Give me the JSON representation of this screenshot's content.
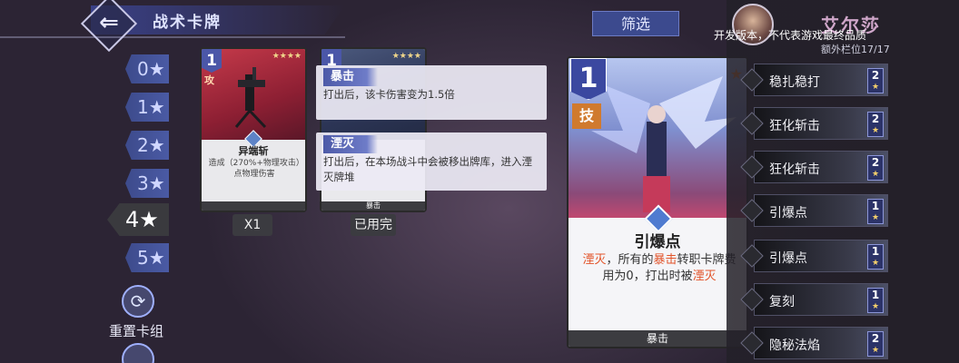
{
  "header": {
    "title": "战术卡牌",
    "back_glyph": "⇐"
  },
  "watermark": "开发版本，不代表游戏最终品质",
  "filter_button": "筛选",
  "star_filters": [
    {
      "label": "0★",
      "active": false
    },
    {
      "label": "1★",
      "active": false
    },
    {
      "label": "2★",
      "active": false
    },
    {
      "label": "3★",
      "active": false
    },
    {
      "label": "4★",
      "active": true
    },
    {
      "label": "5★",
      "active": false
    }
  ],
  "reset_deck": {
    "label": "重置卡组",
    "icon": "refresh-icon"
  },
  "cards": [
    {
      "cost": "1",
      "type": "攻",
      "stars": "★★★★",
      "name": "异端斩",
      "desc": "造成（270%+物理攻击）点物理伤害",
      "footer": "",
      "count": "X1"
    },
    {
      "cost": "1",
      "type": "",
      "stars": "★★★★",
      "name": "",
      "desc": "",
      "footer": "暴击",
      "count": "已用完"
    }
  ],
  "tooltips": [
    {
      "title": "暴击",
      "text": "打出后，该卡伤害变为1.5倍"
    },
    {
      "title": "湮灭",
      "text": "打出后，在本场战斗中会被移出牌库，进入湮灭牌堆"
    }
  ],
  "big_card": {
    "cost": "1",
    "type": "技",
    "star": "★",
    "name": "引爆点",
    "desc_parts": [
      "湮灭",
      "，所有的",
      "暴击",
      "转职卡牌费用为0，打出时被",
      "湮灭"
    ],
    "footer": "暴击"
  },
  "character": {
    "name": "艾尔莎",
    "extra_slot": "额外栏位17/17"
  },
  "deck_list": [
    {
      "label": "稳扎稳打",
      "cost": "2"
    },
    {
      "label": "狂化斩击",
      "cost": "2"
    },
    {
      "label": "狂化斩击",
      "cost": "2"
    },
    {
      "label": "引爆点",
      "cost": "1"
    },
    {
      "label": "引爆点",
      "cost": "1"
    },
    {
      "label": "复刻",
      "cost": "1"
    },
    {
      "label": "隐秘法焰",
      "cost": "2"
    }
  ],
  "colors": {
    "accent_blue": "#3b48a0",
    "highlight_orange": "#e2542a"
  }
}
